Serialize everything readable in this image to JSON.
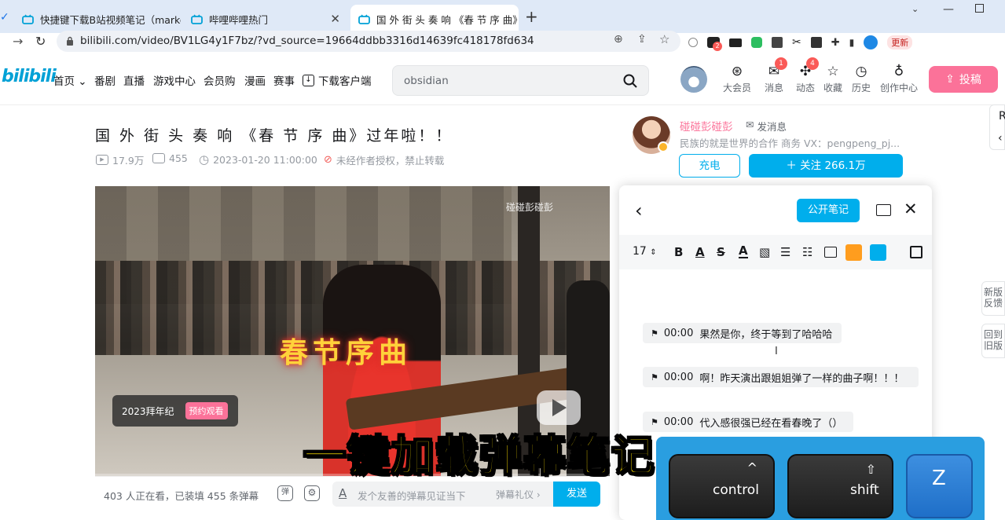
{
  "tabs": [
    {
      "label": "快捷键下载B站视频笔记（marko",
      "active": false
    },
    {
      "label": "哔哩哔哩热门",
      "active": false
    },
    {
      "label": "国 外 街 头 奏 响 《春 节 序 曲》",
      "active": true
    }
  ],
  "new_tab_symbol": "+",
  "close_symbol": "✕",
  "url": "bilibili.com/video/BV1LG4y1F7bz/?vd_source=19664ddbb3316d14639fc418178fd634",
  "ext_badge": "2",
  "ext_label": "更新",
  "header": {
    "logo": "bilibili",
    "nav": [
      "首页",
      "番剧",
      "直播",
      "游戏中心",
      "会员购",
      "漫画",
      "赛事",
      "下载客户端"
    ],
    "search_value": "obsidian",
    "icons": [
      {
        "label": "大会员",
        "badge": ""
      },
      {
        "label": "消息",
        "badge": "1"
      },
      {
        "label": "动态",
        "badge": "4"
      },
      {
        "label": "收藏",
        "badge": ""
      },
      {
        "label": "历史",
        "badge": ""
      },
      {
        "label": "创作中心",
        "badge": ""
      }
    ],
    "upload_label": "投稿"
  },
  "video": {
    "title": "国 外 街 头 奏 响 《春 节 序 曲》过年啦！！",
    "plays": "17.9万",
    "danmaku_count": "455",
    "date": "2023-01-20 11:00:00",
    "copyright": "未经作者授权，禁止转载",
    "watermark": "碰碰彭碰彭",
    "overlay_title": "春节序曲",
    "promo_label": "2023拜年纪",
    "promo_button": "预约观看",
    "watching": "403 人正在看，已装填 455 条弹幕",
    "danmaku_icon1": "弹",
    "danmaku_placeholder": "发个友善的弹幕见证当下",
    "danmaku_etiquette": "弹幕礼仪",
    "send_label": "发送"
  },
  "uploader": {
    "name": "碰碰彭碰彭",
    "message_label": "发消息",
    "desc": "民族的就是世界的合作 商务 VX：pengpeng_pj...",
    "charge_label": "充电",
    "follow_label": "＋ 关注 266.1万"
  },
  "notes": {
    "public_label": "公开笔记",
    "font_size": "17",
    "lines": [
      {
        "time": "00:00",
        "text": "果然是你，终于等到了哈哈哈"
      },
      {
        "time": "00:00",
        "text": "啊！昨天演出跟姐姐弹了一样的曲子啊！！！"
      },
      {
        "time": "00:00",
        "text": "代入感很强已经在看春晚了（）"
      }
    ]
  },
  "caption": "一键加载弹幕笔记",
  "keys": [
    {
      "label": "control",
      "glyph": "^"
    },
    {
      "label": "shift",
      "glyph": "⇧"
    },
    {
      "label": "Z",
      "glyph": ""
    }
  ],
  "side_tabs": [
    "新版反馈",
    "回到旧版"
  ],
  "side_letter": "R",
  "colors": {
    "accent": "#00aeec",
    "pink": "#fb7299",
    "caption": "#ffe100"
  }
}
